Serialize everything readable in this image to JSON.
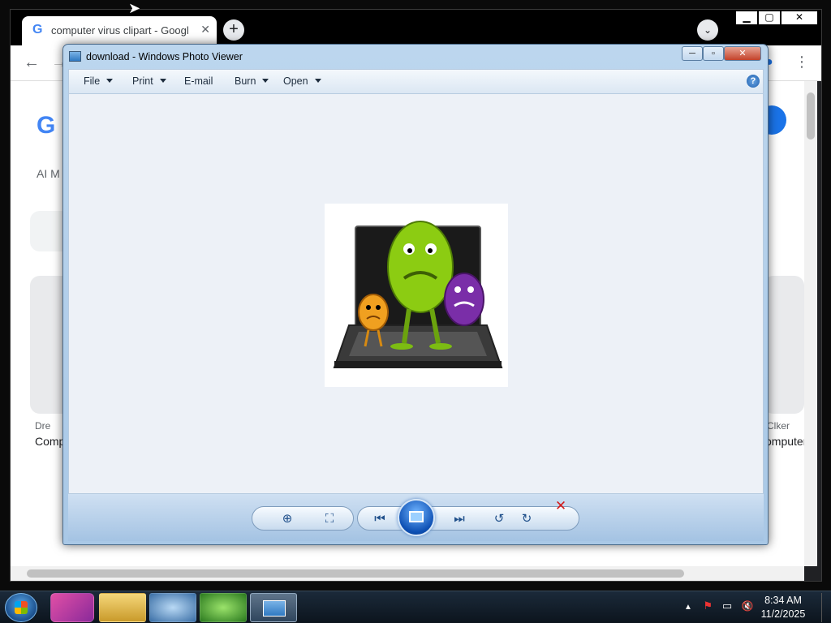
{
  "browser": {
    "tab_title": "computer virus clipart - Google",
    "tab_favicon": "G",
    "tab_close": "✕",
    "new_tab": "+",
    "tab_search": "⌄",
    "window_controls": {
      "minimize": "▁",
      "maximize": "▢",
      "close": "✕"
    },
    "nav": {
      "back": "←",
      "forward": "→",
      "profile": "●",
      "menu": "⋮"
    },
    "page": {
      "logo_partial": "G",
      "ai_mode_partial": "AI M",
      "card_left_source": "Dre",
      "card_left_title": "Comp",
      "card_right_source": "Clker",
      "card_right_title": "omputer"
    }
  },
  "photo_viewer": {
    "title": "download - Windows Photo Viewer",
    "caption": {
      "minimize": "─",
      "maximize": "▫",
      "close": "✕"
    },
    "menu": [
      {
        "label": "File"
      },
      {
        "label": "Print"
      },
      {
        "label": "E-mail"
      },
      {
        "label": "Burn"
      },
      {
        "label": "Open"
      }
    ],
    "help": "?",
    "image_description": "laptop-with-virus-monsters",
    "controls": {
      "zoom": "⊕",
      "fit": "⛶",
      "previous": "⏮",
      "next": "⏭",
      "rotate_ccw": "↺",
      "rotate_cw": "↻",
      "delete": "✕"
    }
  },
  "taskbar": {
    "pinned": [
      "start-orb",
      "app-pink",
      "file-explorer",
      "browser-globe",
      "download-manager",
      "photo-viewer"
    ],
    "tray_icons": [
      "▲",
      "⚑",
      "▭",
      "🔇"
    ],
    "time": "8:34 AM",
    "date": "11/2/2025"
  },
  "colors": {
    "viewer_chrome": "#bcd6ee",
    "canvas_bg": "#edf1f7",
    "slideshow_blue": "#0d4fb3",
    "delete_red": "#d31b1b"
  }
}
